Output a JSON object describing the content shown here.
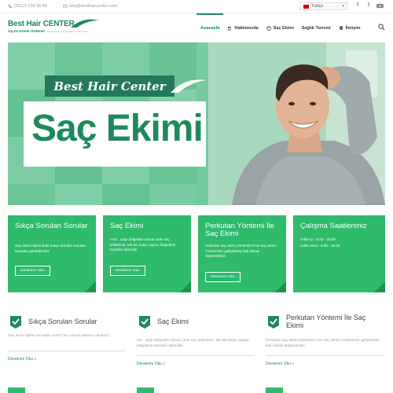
{
  "topbar": {
    "phone": "(0212) 234 96 99",
    "email": "info@besthaircenter.com",
    "language": "Türkçe",
    "social": [
      "f",
      "t",
      "yt"
    ]
  },
  "header": {
    "logo_brand": "Best Hair",
    "logo_brand_caps": "CENTER",
    "logo_sub": "Op.Dr.Azmet Özdemir",
    "logo_tagline": "Estetik Plastik ve Rekonstrüktif Cerrahi Uzmanı"
  },
  "nav": {
    "items": [
      {
        "label": "Anasayfa",
        "icon": "none"
      },
      {
        "label": "Hakkımızda",
        "icon": "group-icon"
      },
      {
        "label": "Saç Ekimi",
        "icon": "hair-icon"
      },
      {
        "label": "Sağlık Turizmi",
        "icon": "none"
      },
      {
        "label": "İletişim",
        "icon": "location-icon"
      }
    ]
  },
  "hero": {
    "ribbon": "Best Hair Center",
    "title": "Saç Ekimi"
  },
  "cards": [
    {
      "title": "Sıkça Sorulan Sorular",
      "text": "Saç ekimi hakkındaki Sıkça Sorulan Sorulan buradan görebilirsiniz",
      "button": "Devamını Oku"
    },
    {
      "title": "Saç Ekimi",
      "text": "FUE , saçlı bölgeden alınan canlı saç köklerinin, tek tek başın saçsız bölgesine transferi işlemidir.",
      "button": "Devamını Oku"
    },
    {
      "title": "Perkutan Yöntemi İle Saç Ekimi",
      "text": "Perkutan saç ekimi yöntemini Fue Saç Ekimi Yönteminin geliştirilmiş hali olarak düşünebiliriz.",
      "button": "Devamını Oku"
    },
    {
      "title": "Çalışma Saatlerimiz",
      "hours": [
        "Hafta içi : 8.00 - 19.00",
        "Hafta sonu : 9.00 - 18.00"
      ]
    }
  ],
  "info": [
    {
      "title": "Sıkça Sorulan Sorular",
      "text": "Saç ekimi işlemi ne kadar sürer? Ne zaman taburcu olursuz?...",
      "link": "Devamını Oku »"
    },
    {
      "title": "Saç Ekimi",
      "text": "UE , saçlı bölgeden alınan canlı saç köklerinin, tek tek başın saçsız bölgesine transferi işlemidir.",
      "link": "Devamını Oku »"
    },
    {
      "title": "Perkutan Yöntemi İle Saç Ekimi",
      "text": "Perkutan saç ekimi yöntemini Fue Saç Ekimi Yönteminin geliştirilmiş hali olarak düşünebiliriz.",
      "link": "Devamını Oku »"
    }
  ],
  "colors": {
    "brand_green": "#1e8a5b",
    "card_green": "#2fba6c",
    "hero_green": "#6fc79a"
  }
}
